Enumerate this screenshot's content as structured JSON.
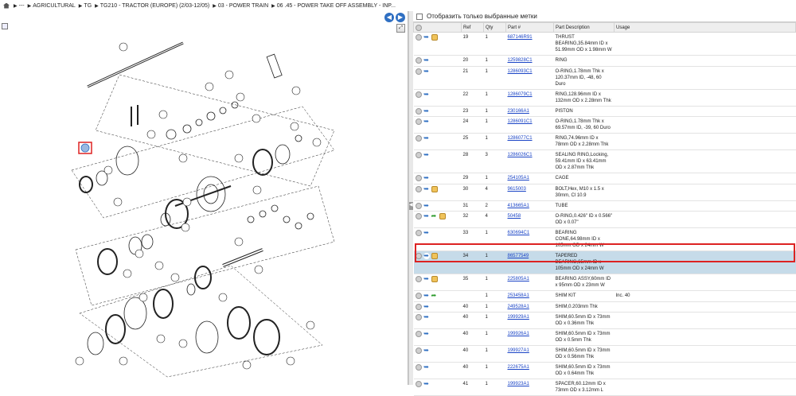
{
  "breadcrumb": {
    "home_icon": "home-icon",
    "items": [
      "---",
      "AGRICULTURAL",
      "TG",
      "TG210 - TRACTOR (EUROPE) (2/03-12/05)",
      "03 - POWER TRAIN",
      "06 .45 - POWER TAKE OFF ASSEMBLY - INP..."
    ]
  },
  "filter": {
    "label": "Отобразить только выбранные метки"
  },
  "table": {
    "headers": [
      "",
      "Ref",
      "Qty",
      "Part #",
      "Part Description",
      "Usage"
    ],
    "rows": [
      {
        "ref": "19",
        "qty": "1",
        "part": "687146R91",
        "desc": "THRUST BEARING,35.84mm ID x 51.99mm OD x 1.98mm W",
        "usage": "",
        "icons": [
          "grey",
          "blue",
          "pkg"
        ]
      },
      {
        "ref": "20",
        "qty": "1",
        "part": "1259828C1",
        "desc": "RING",
        "usage": "",
        "icons": [
          "grey",
          "blue"
        ]
      },
      {
        "ref": "21",
        "qty": "1",
        "part": "1286093C1",
        "desc": "O-RING,1.78mm Thk x 120.37mm ID, -48, 60 Duro",
        "usage": "",
        "icons": [
          "grey",
          "blue"
        ]
      },
      {
        "ref": "22",
        "qty": "1",
        "part": "1286079C1",
        "desc": "RING,128.96mm ID x 132mm OD x 2.28mm Thk",
        "usage": "",
        "icons": [
          "grey",
          "blue"
        ]
      },
      {
        "ref": "23",
        "qty": "1",
        "part": "230166A1",
        "desc": "PISTON",
        "usage": "",
        "icons": [
          "grey",
          "blue"
        ]
      },
      {
        "ref": "24",
        "qty": "1",
        "part": "1286091C1",
        "desc": "O-RING,1.78mm Thk x 69.57mm ID, -39, 60 Duro",
        "usage": "",
        "icons": [
          "grey",
          "blue"
        ]
      },
      {
        "ref": "25",
        "qty": "1",
        "part": "1286077C1",
        "desc": "RING,74.96mm ID x 78mm OD x 2.28mm Thk",
        "usage": "",
        "icons": [
          "grey",
          "blue"
        ]
      },
      {
        "ref": "28",
        "qty": "3",
        "part": "1286026C1",
        "desc": "SEALING RING,Locking, 59.41mm ID x 63.41mm OD x 2.87mm Thk",
        "usage": "",
        "icons": [
          "grey",
          "blue"
        ]
      },
      {
        "ref": "29",
        "qty": "1",
        "part": "254105A1",
        "desc": "CAGE",
        "usage": "",
        "icons": [
          "grey",
          "blue"
        ]
      },
      {
        "ref": "30",
        "qty": "4",
        "part": "9615003",
        "desc": "BOLT,Hex, M10 x 1.5 x 30mm, Cl 10.9",
        "usage": "",
        "icons": [
          "grey",
          "blue",
          "pkg"
        ]
      },
      {
        "ref": "31",
        "qty": "2",
        "part": "413665A1",
        "desc": "TUBE",
        "usage": "",
        "icons": [
          "grey",
          "blue"
        ]
      },
      {
        "ref": "32",
        "qty": "4",
        "part": "50458",
        "desc": "O-RING,0.426\" ID x 0.566\" OD x 0.07\"",
        "usage": "",
        "icons": [
          "grey",
          "blue",
          "green",
          "pkg"
        ]
      },
      {
        "ref": "33",
        "qty": "1",
        "part": "630694C1",
        "desc": "BEARING CONE,64.98mm ID x 105mm OD x 24mm W",
        "usage": "",
        "icons": [
          "grey",
          "blue"
        ]
      },
      {
        "ref": "34",
        "qty": "1",
        "part": "86577549",
        "desc": "TAPERED BEARING,65mm ID x 105mm OD x 24mm W",
        "usage": "",
        "icons": [
          "grey",
          "blue",
          "pkg"
        ],
        "selected": true
      },
      {
        "ref": "35",
        "qty": "1",
        "part": "225805A1",
        "desc": "BEARING ASSY,60mm ID x 95mm OD x 23mm W",
        "usage": "",
        "icons": [
          "grey",
          "blue",
          "pkg"
        ]
      },
      {
        "ref": "",
        "qty": "1",
        "part": "253458A1",
        "desc": "SHIM KIT",
        "usage": "Inc. 40",
        "icons": [
          "grey",
          "blue",
          "green"
        ]
      },
      {
        "ref": "40",
        "qty": "1",
        "part": "249528A1",
        "desc": "SHIM,0.203mm Thk",
        "usage": "",
        "icons": [
          "grey",
          "blue"
        ]
      },
      {
        "ref": "40",
        "qty": "1",
        "part": "199929A1",
        "desc": "SHIM,60.5mm ID x 73mm OD x 0.36mm Thk",
        "usage": "",
        "icons": [
          "grey",
          "blue"
        ]
      },
      {
        "ref": "40",
        "qty": "1",
        "part": "199926A1",
        "desc": "SHIM,60.5mm ID x 73mm OD x 0.5mm Thk",
        "usage": "",
        "icons": [
          "grey",
          "blue"
        ]
      },
      {
        "ref": "40",
        "qty": "1",
        "part": "199927A1",
        "desc": "SHIM,60.5mm ID x 73mm OD x 0.56mm Thk",
        "usage": "",
        "icons": [
          "grey",
          "blue"
        ]
      },
      {
        "ref": "40",
        "qty": "1",
        "part": "222675A1",
        "desc": "SHIM,60.5mm ID x 73mm OD x 0.64mm Thk",
        "usage": "",
        "icons": [
          "grey",
          "blue"
        ]
      },
      {
        "ref": "41",
        "qty": "1",
        "part": "199923A1",
        "desc": "SPACER,60.12mm ID x 73mm OD x 3.12mm L",
        "usage": "",
        "icons": [
          "grey",
          "blue"
        ]
      }
    ]
  }
}
